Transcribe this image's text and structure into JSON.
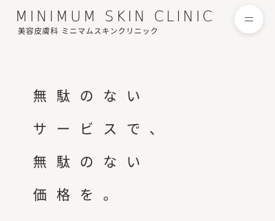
{
  "header": {
    "logo_text": "MINIMUM SKIN CLINIC",
    "logo_subtitle": "美容皮膚科 ミニマムスキンクリニック",
    "menu_icon": "hamburger-menu-icon"
  },
  "hero": {
    "lines": [
      "無駄のない",
      "サービスで、",
      "無駄のない",
      "価格を。"
    ]
  },
  "colors": {
    "background": "#f7f6f4",
    "text": "#2a2a2a",
    "menu_button_bg": "#ffffff"
  }
}
